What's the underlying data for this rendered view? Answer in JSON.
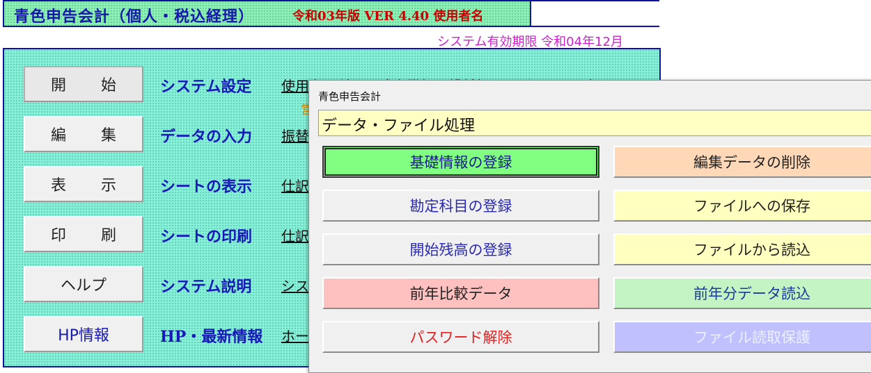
{
  "header": {
    "title": "青色申告会計（個人・税込経理）",
    "version": "令和03年版 VER 4.40 使用者名",
    "user_name": ""
  },
  "expiry": "システム有効期限 令和04年12月",
  "menu": [
    {
      "button": "開　始",
      "label": "システム設定",
      "link": "使用者　科目　残高登録　繰越処理　バージョン処理"
    },
    {
      "button": "編　集",
      "label": "データの入力",
      "link": "振替"
    },
    {
      "button": "表　示",
      "label": "シートの表示",
      "link": "仕訳"
    },
    {
      "button": "印　刷",
      "label": "シートの印刷",
      "link": "仕訳"
    },
    {
      "button": "ヘルプ",
      "label": "システム説明",
      "link": "シス"
    },
    {
      "button": "HP情報",
      "label": "HP・最新情報",
      "link": "ホー"
    }
  ],
  "orange_note": "営",
  "dialog": {
    "title": "青色申告会計",
    "header": "データ・ファイル処理",
    "buttons_left": [
      {
        "label": "基礎情報の登録",
        "bg": "#80ff80",
        "color": "#1a1a8a"
      },
      {
        "label": "勘定科目の登録",
        "bg": "#f0f0f0",
        "color": "#2a2ab0"
      },
      {
        "label": "開始残高の登録",
        "bg": "#f0f0f0",
        "color": "#2a2ab0"
      },
      {
        "label": "前年比較データ",
        "bg": "#ffc0c0",
        "color": "#222222"
      },
      {
        "label": "パスワード解除",
        "bg": "#f0f0f0",
        "color": "#dd2222"
      }
    ],
    "buttons_right": [
      {
        "label": "編集データの削除",
        "bg": "#ffd8b8",
        "color": "#222222"
      },
      {
        "label": "ファイルへの保存",
        "bg": "#ffffc0",
        "color": "#222222"
      },
      {
        "label": "ファイルから読込",
        "bg": "#ffffc0",
        "color": "#222222"
      },
      {
        "label": "前年分データ読込",
        "bg": "#c4f4c4",
        "color": "#1a3a9a"
      },
      {
        "label": "ファイル読取保護",
        "bg": "#c0c0ff",
        "color": "#eef0ff"
      }
    ]
  }
}
